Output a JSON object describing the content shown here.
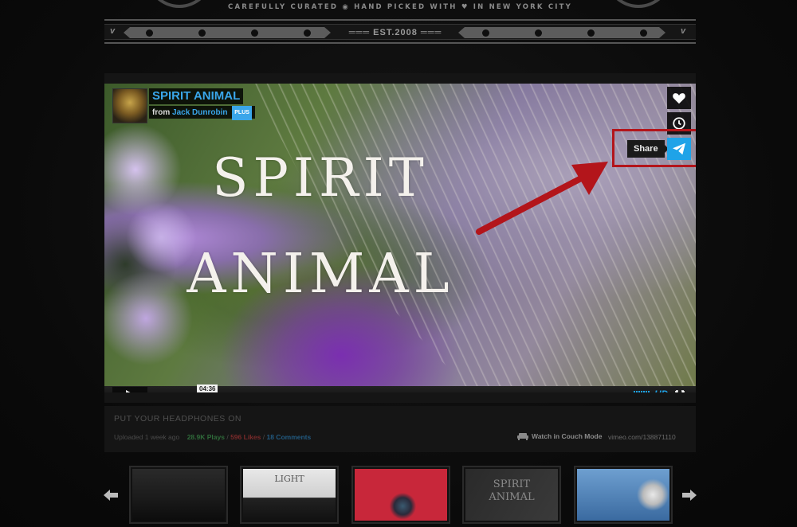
{
  "header": {
    "tagline": "CAREFULLY CURATED ◉ HAND PICKED WITH ♥ IN NEW YORK CITY",
    "est": "═══ EST.2008 ═══",
    "v_left": "v",
    "v_right": "v"
  },
  "player": {
    "overlay_title_line1": "SPIRIT",
    "overlay_title_line2": "ANIMAL",
    "title": "SPIRIT ANIMAL",
    "from_prefix": "from",
    "author": "Jack Dunrobin",
    "badge": "PLUS",
    "share_label": "Share",
    "hover_time": "04:36",
    "progress": 0.02,
    "quality": "HD",
    "accent": "#1fa3e8",
    "highlight": "#b3151b"
  },
  "info": {
    "caption": "PUT YOUR HEADPHONES ON",
    "uploaded": "Uploaded 1 week ago",
    "plays": "28.9K Plays",
    "likes": "596 Likes",
    "comments": "18 Comments",
    "sep": "/",
    "couch_mode": "Watch in Couch Mode",
    "url": "vimeo.com/138871110"
  },
  "thumbnails": [
    {
      "name": "dark-landscape"
    },
    {
      "name": "light-forest",
      "label": "LIGHT"
    },
    {
      "name": "red-figure"
    },
    {
      "name": "spirit-animal",
      "label": "SPIRIT ANIMAL"
    },
    {
      "name": "astronaut-sky"
    }
  ]
}
